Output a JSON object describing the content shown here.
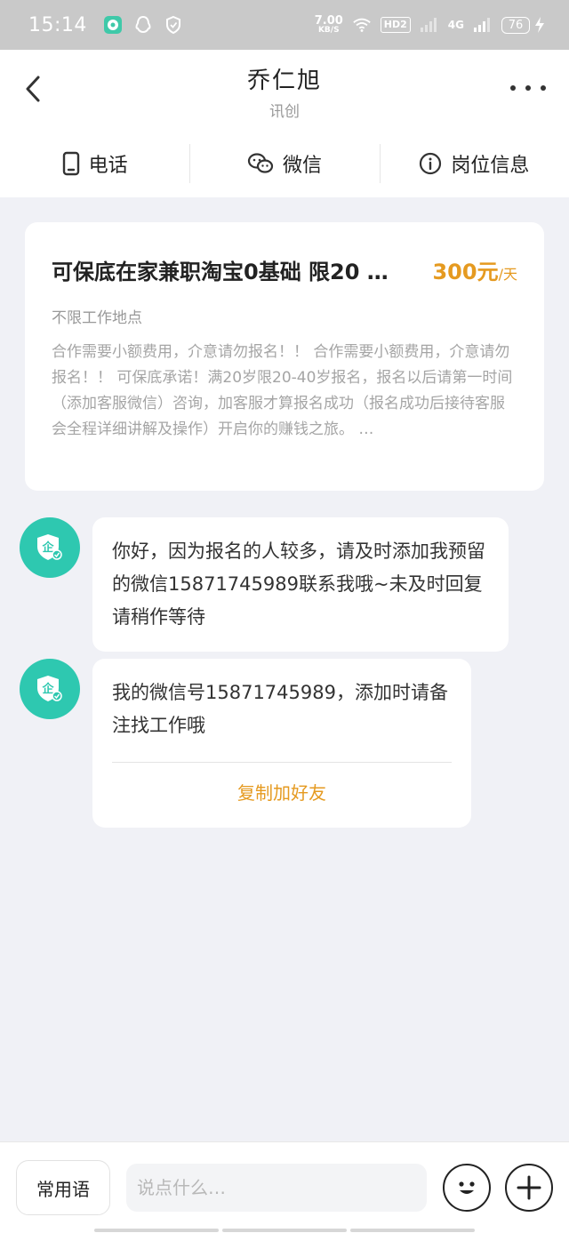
{
  "status_bar": {
    "time": "15:14",
    "net_speed": "7.00",
    "net_unit": "KB/S",
    "hd_badge": "HD2",
    "network_type": "4G",
    "battery": "76",
    "icons": [
      "chat-app-icon",
      "qq-icon",
      "shield-icon",
      "wifi-icon",
      "signal-icon",
      "charging-icon"
    ]
  },
  "header": {
    "title": "乔仁旭",
    "subtitle": "讯创"
  },
  "actions": [
    {
      "label": "电话",
      "icon": "phone-icon"
    },
    {
      "label": "微信",
      "icon": "wechat-icon"
    },
    {
      "label": "岗位信息",
      "icon": "info-icon"
    }
  ],
  "job": {
    "title": "可保底在家兼职淘宝0基础 限20 …",
    "salary": "300元",
    "salary_unit": "/天",
    "location": "不限工作地点",
    "description": "合作需要小额费用，介意请勿报名！！ 合作需要小额费用，介意请勿报名！！ 可保底承诺！满20岁限20-40岁报名，报名以后请第一时间（添加客服微信）咨询，加客服才算报名成功（报名成功后接待客服会全程详细讲解及操作）开启你的赚钱之旅。 …"
  },
  "messages": [
    {
      "text": "你好，因为报名的人较多，请及时添加我预留的微信15871745989联系我哦~未及时回复请稍作等待"
    },
    {
      "text": "我的微信号15871745989，添加时请备注找工作哦",
      "action": "复制加好友"
    }
  ],
  "bottom_bar": {
    "phrase_label": "常用语",
    "input_placeholder": "说点什么…",
    "emoji_icon": "emoji-icon",
    "plus_icon": "plus-icon"
  },
  "colors": {
    "accent": "#e59a20",
    "avatar": "#2ec8b0",
    "background": "#f0f1f6",
    "status_bar": "#c9c9c9"
  }
}
